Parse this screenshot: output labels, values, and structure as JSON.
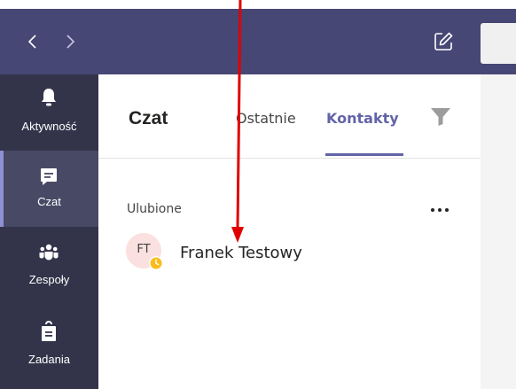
{
  "rail": {
    "items": [
      {
        "label": "Aktywność",
        "icon": "bell-icon"
      },
      {
        "label": "Czat",
        "icon": "chat-icon"
      },
      {
        "label": "Zespoły",
        "icon": "teams-icon"
      },
      {
        "label": "Zadania",
        "icon": "tasks-icon"
      }
    ]
  },
  "topbar": {
    "back_icon": "chevron-left-icon",
    "forward_icon": "chevron-right-icon",
    "compose_icon": "compose-icon"
  },
  "chat": {
    "title": "Czat",
    "tabs": [
      {
        "label": "Ostatnie"
      },
      {
        "label": "Kontakty"
      }
    ],
    "active_tab": "Kontakty",
    "filter_icon": "filter-icon"
  },
  "favorites": {
    "label": "Ulubione",
    "more_icon": "more-options-icon",
    "contacts": [
      {
        "initials": "FT",
        "name": "Franek Testowy",
        "status": "away",
        "status_icon": "clock-icon"
      }
    ]
  },
  "colors": {
    "topbar": "#464775",
    "rail": "#33344a",
    "rail_active": "#484965",
    "accent": "#6264a7",
    "avatar_bg": "#fbe0e0",
    "status_away": "#fbbc1b",
    "annotation": "#e00000"
  }
}
